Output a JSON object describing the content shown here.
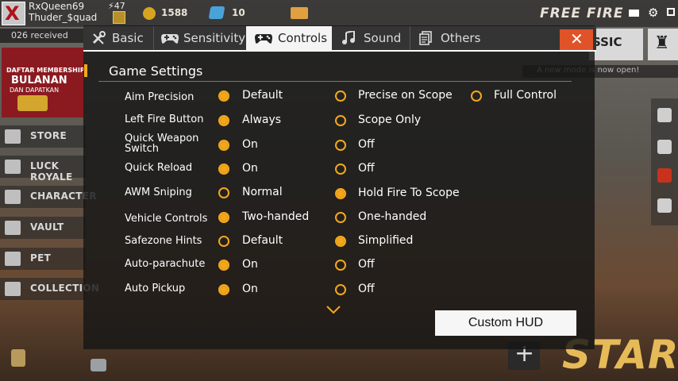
{
  "lobby": {
    "player_name": "RxQueen69",
    "squad_name": "Thuder_$quad",
    "level": "47",
    "coins": "1588",
    "diamonds": "10",
    "received_text": "026 received",
    "logo": "FREE FIRE",
    "membership": {
      "line1": "DAFTAR MEMBERSHIP",
      "line2": "BULANAN",
      "line3": "DAN DAPATKAN"
    },
    "notice": "A new mode is now open!",
    "mode_label": "SSIC",
    "side_menu": [
      "STORE",
      "LUCK ROYALE",
      "CHARACTER",
      "VAULT",
      "PET",
      "COLLECTION"
    ],
    "start_label": "START"
  },
  "tabs": [
    {
      "label": "Basic",
      "icon": "wrench-icon"
    },
    {
      "label": "Sensitivity",
      "icon": "gamepad-icon"
    },
    {
      "label": "Controls",
      "icon": "controller-icon",
      "active": true
    },
    {
      "label": "Sound",
      "icon": "music-note-icon"
    },
    {
      "label": "Others",
      "icon": "document-icon"
    }
  ],
  "close_label": "✕",
  "section_title": "Game Settings",
  "settings": [
    {
      "label": "Aim Precision",
      "options": [
        "Default",
        "Precise on Scope",
        "Full Control"
      ],
      "selected": 0
    },
    {
      "label": "Left Fire Button",
      "options": [
        "Always",
        "Scope Only"
      ],
      "selected": 0
    },
    {
      "label": "Quick Weapon Switch",
      "options": [
        "On",
        "Off"
      ],
      "selected": 0
    },
    {
      "label": "Quick Reload",
      "options": [
        "On",
        "Off"
      ],
      "selected": 0
    },
    {
      "label": "AWM Sniping",
      "options": [
        "Normal",
        "Hold Fire To Scope"
      ],
      "selected": 1
    },
    {
      "label": "Vehicle Controls",
      "options": [
        "Two-handed",
        "One-handed"
      ],
      "selected": 0
    },
    {
      "label": "Safezone Hints",
      "options": [
        "Default",
        "Simplified"
      ],
      "selected": 1
    },
    {
      "label": "Auto-parachute",
      "options": [
        "On",
        "Off"
      ],
      "selected": 0
    },
    {
      "label": "Auto Pickup",
      "options": [
        "On",
        "Off"
      ],
      "selected": 0
    }
  ],
  "custom_hud_label": "Custom HUD",
  "colors": {
    "accent": "#f3a81b",
    "close": "#e05328"
  }
}
